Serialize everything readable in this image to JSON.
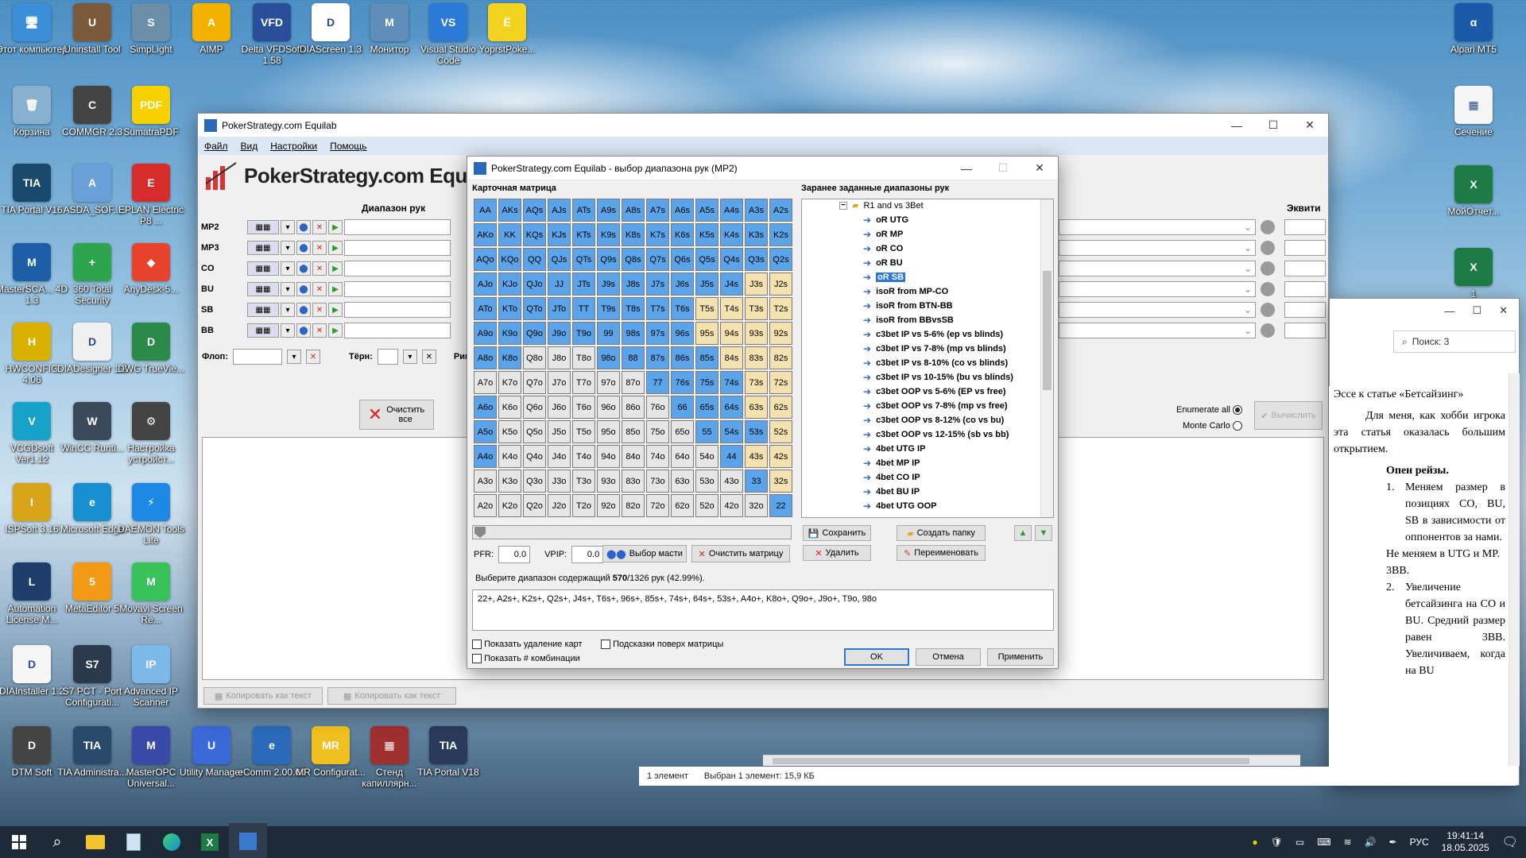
{
  "desktop_icons": [
    {
      "label": "Этот компьютер",
      "color": "#3b8fd9",
      "glyph": "🖥"
    },
    {
      "label": "Uninstall Tool",
      "color": "#7a5a3a",
      "glyph": "U"
    },
    {
      "label": "SimpLight",
      "color": "#6b8fa8",
      "glyph": "S"
    },
    {
      "label": "AIMP",
      "color": "#f2b100",
      "glyph": "A"
    },
    {
      "label": "Delta VFDSoft 1.58",
      "color": "#2a4f9a",
      "glyph": "VFD"
    },
    {
      "label": "DIAScreen 1.3",
      "color": "#ffffff",
      "glyph": "D"
    },
    {
      "label": "Монитор",
      "color": "#5f8fb8",
      "glyph": "M"
    },
    {
      "label": "Visual Studio Code",
      "color": "#2b7bd6",
      "glyph": "VS"
    },
    {
      "label": "YoprstPoke...",
      "color": "#f1d21f",
      "glyph": "Ё"
    },
    {
      "label": "Корзина",
      "color": "#8ab0cf",
      "glyph": "🗑"
    },
    {
      "label": "COMMGR 2.3",
      "color": "#444",
      "glyph": "C"
    },
    {
      "label": "SumatraPDF",
      "color": "#f7d000",
      "glyph": "PDF"
    },
    {
      "label": "TIA Portal V16",
      "color": "#1a4a6b",
      "glyph": "TIA"
    },
    {
      "label": "ASDA_SOF...",
      "color": "#6aa0d8",
      "glyph": "A"
    },
    {
      "label": "EPLAN Electric P8 ...",
      "color": "#d62c2c",
      "glyph": "E"
    },
    {
      "label": "MasterSCA... 4D 1.3",
      "color": "#1c5fa8",
      "glyph": "M"
    },
    {
      "label": "360 Total Security",
      "color": "#2ea44f",
      "glyph": "+"
    },
    {
      "label": "AnyDesk-5...",
      "color": "#e8432d",
      "glyph": "◆"
    },
    {
      "label": "HWCONFIG 4.06",
      "color": "#d9b100",
      "glyph": "H"
    },
    {
      "label": "DIADesigner 1.3",
      "color": "#f0f0f0",
      "glyph": "D"
    },
    {
      "label": "DWG TrueVie...",
      "color": "#2b8a4a",
      "glyph": "D"
    },
    {
      "label": "VCGDsoft Ver1.12",
      "color": "#17a2c9",
      "glyph": "V"
    },
    {
      "label": "WinCC Runti...",
      "color": "#3a4a5a",
      "glyph": "W"
    },
    {
      "label": "Настройка устройст...",
      "color": "#444",
      "glyph": "⚙"
    },
    {
      "label": "ISPSoft 3.16",
      "color": "#d8a51a",
      "glyph": "I"
    },
    {
      "label": "Microsoft Edge",
      "color": "#1a8fd0",
      "glyph": "e"
    },
    {
      "label": "DAEMON Tools Lite",
      "color": "#1e88e5",
      "glyph": "⚡"
    },
    {
      "label": "Automation License M...",
      "color": "#1f3d6b",
      "glyph": "L"
    },
    {
      "label": "MetaEditor 5",
      "color": "#f29a16",
      "glyph": "5"
    },
    {
      "label": "Movavi Screen Re...",
      "color": "#37c25a",
      "glyph": "M"
    },
    {
      "label": "DIAInstaller 1.2",
      "color": "#f5f5f5",
      "glyph": "D"
    },
    {
      "label": "S7 PCT - Port Configurati...",
      "color": "#2a3a4a",
      "glyph": "S7"
    },
    {
      "label": "Advanced IP Scanner",
      "color": "#7cb9e8",
      "glyph": "IP"
    },
    {
      "label": "DTM Soft",
      "color": "#444",
      "glyph": "D"
    },
    {
      "label": "TIA Administra...",
      "color": "#2a4a6b",
      "glyph": "TIA"
    },
    {
      "label": "MasterOPC Universal...",
      "color": "#3a4aa8",
      "glyph": "M"
    },
    {
      "label": "Utility Manager",
      "color": "#3a6ad8",
      "glyph": "U"
    },
    {
      "label": "eComm 2.00.00",
      "color": "#2a6ab8",
      "glyph": "e"
    },
    {
      "label": "MR Configurat...",
      "color": "#f0c020",
      "glyph": "MR"
    },
    {
      "label": "Стенд капиллярн...",
      "color": "#a03030",
      "glyph": "▦"
    },
    {
      "label": "TIA Portal V18",
      "color": "#2a3a5a",
      "glyph": "TIA"
    },
    {
      "label": "Alpari MT5",
      "color": "#1a5aa8",
      "glyph": "α"
    },
    {
      "label": "Сечение",
      "color": "#f5f5f5",
      "glyph": "▦"
    },
    {
      "label": "МойОтчет...",
      "color": "#1e7b45",
      "glyph": "X"
    },
    {
      "label": "1",
      "color": "#1e7b45",
      "glyph": "X"
    }
  ],
  "main_window": {
    "title": "PokerStrategy.com Equilab",
    "menu": [
      "Файл",
      "Вид",
      "Настройки",
      "Помощь"
    ],
    "logo_text": "PokerStrategy.com Equ",
    "range_header": "Диапазон рук",
    "equity_header": "Эквити",
    "players": [
      "MP2",
      "MP3",
      "CO",
      "BU",
      "SB",
      "BB"
    ],
    "flop_label": "Флоп:",
    "turn_label": "Тёрн:",
    "river_label": "Ривер:",
    "clear_all": "Очистить все",
    "enumerate_all": "Enumerate all",
    "monte_carlo": "Monte Carlo",
    "calculate": "Вычислить",
    "copy_text_1": "Копировать как текст",
    "copy_text_2": "Копировать как текст"
  },
  "dialog": {
    "title": "PokerStrategy.com Equilab - выбор диапазона рук (MP2)",
    "matrix_label": "Карточная матрица",
    "preset_label": "Заранее заданные диапазоны рук",
    "pfr_label": "PFR:",
    "pfr_value": "0.0",
    "vpip_label": "VPIP:",
    "vpip_value": "0.0",
    "suit_button": "Выбор масти",
    "clear_matrix": "Очистить матрицу",
    "save": "Сохранить",
    "create_folder": "Создать папку",
    "delete": "Удалить",
    "rename": "Переименовать",
    "summary_prefix": "Выберите диапазон содержащий ",
    "summary_count": "570",
    "summary_suffix": "/1326 рук (42.99%).",
    "range_text": "22+, A2s+, K2s+, Q2s+, J4s+, T6s+, 96s+, 85s+, 74s+, 64s+, 53s+, A4o+, K8o+, Q9o+, J9o+, T9o, 98o",
    "show_card_removal": "Показать удаление карт",
    "show_hints": "Подсказки поверх матрицы",
    "show_combos": "Показать # комбинации",
    "ok": "OK",
    "cancel": "Отмена",
    "apply": "Применить",
    "tree_folder": "R1 and vs 3Bet",
    "tree_items": [
      "oR UTG",
      "oR MP",
      "oR CO",
      "oR BU",
      "oR SB",
      "isoR from MP-CO",
      "isoR from BTN-BB",
      "isoR from BBvsSB",
      "c3bet IP vs 5-6% (ep vs blinds)",
      "c3bet IP vs 7-8% (mp vs blinds)",
      "c3bet IP vs 8-10% (co vs blinds)",
      "c3bet IP vs 10-15% (bu vs blinds)",
      "c3bet OOP vs 5-6% (EP vs free)",
      "c3bet OOP vs 7-8% (mp vs free)",
      "c3bet OOP vs 8-12% (co vs bu)",
      "c3bet OOP vs 12-15% (sb vs bb)",
      "4bet UTG IP",
      "4bet MP IP",
      "4bet CO IP",
      "4bet BU IP",
      "4bet UTG OOP"
    ],
    "tree_selected": "oR SB"
  },
  "chart_data": {
    "type": "table",
    "ranks": [
      "A",
      "K",
      "Q",
      "J",
      "T",
      "9",
      "8",
      "7",
      "6",
      "5",
      "4",
      "3",
      "2"
    ],
    "cells": [
      [
        "AA",
        "AKs",
        "AQs",
        "AJs",
        "ATs",
        "A9s",
        "A8s",
        "A7s",
        "A6s",
        "A5s",
        "A4s",
        "A3s",
        "A2s"
      ],
      [
        "AKo",
        "KK",
        "KQs",
        "KJs",
        "KTs",
        "K9s",
        "K8s",
        "K7s",
        "K6s",
        "K5s",
        "K4s",
        "K3s",
        "K2s"
      ],
      [
        "AQo",
        "KQo",
        "QQ",
        "QJs",
        "QTs",
        "Q9s",
        "Q8s",
        "Q7s",
        "Q6s",
        "Q5s",
        "Q4s",
        "Q3s",
        "Q2s"
      ],
      [
        "AJo",
        "KJo",
        "QJo",
        "JJ",
        "JTs",
        "J9s",
        "J8s",
        "J7s",
        "J6s",
        "J5s",
        "J4s",
        "J3s",
        "J2s"
      ],
      [
        "ATo",
        "KTo",
        "QTo",
        "JTo",
        "TT",
        "T9s",
        "T8s",
        "T7s",
        "T6s",
        "T5s",
        "T4s",
        "T3s",
        "T2s"
      ],
      [
        "A9o",
        "K9o",
        "Q9o",
        "J9o",
        "T9o",
        "99",
        "98s",
        "97s",
        "96s",
        "95s",
        "94s",
        "93s",
        "92s"
      ],
      [
        "A8o",
        "K8o",
        "Q8o",
        "J8o",
        "T8o",
        "98o",
        "88",
        "87s",
        "86s",
        "85s",
        "84s",
        "83s",
        "82s"
      ],
      [
        "A7o",
        "K7o",
        "Q7o",
        "J7o",
        "T7o",
        "97o",
        "87o",
        "77",
        "76s",
        "75s",
        "74s",
        "73s",
        "72s"
      ],
      [
        "A6o",
        "K6o",
        "Q6o",
        "J6o",
        "T6o",
        "96o",
        "86o",
        "76o",
        "66",
        "65s",
        "64s",
        "63s",
        "62s"
      ],
      [
        "A5o",
        "K5o",
        "Q5o",
        "J5o",
        "T5o",
        "95o",
        "85o",
        "75o",
        "65o",
        "55",
        "54s",
        "53s",
        "52s"
      ],
      [
        "A4o",
        "K4o",
        "Q4o",
        "J4o",
        "T4o",
        "94o",
        "84o",
        "74o",
        "64o",
        "54o",
        "44",
        "43s",
        "42s"
      ],
      [
        "A3o",
        "K3o",
        "Q3o",
        "J3o",
        "T3o",
        "93o",
        "83o",
        "73o",
        "63o",
        "53o",
        "43o",
        "33",
        "32s"
      ],
      [
        "A2o",
        "K2o",
        "Q2o",
        "J2o",
        "T2o",
        "92o",
        "82o",
        "72o",
        "62o",
        "52o",
        "42o",
        "32o",
        "22"
      ]
    ],
    "selected": [
      "AA",
      "AKs",
      "AQs",
      "AJs",
      "ATs",
      "A9s",
      "A8s",
      "A7s",
      "A6s",
      "A5s",
      "A4s",
      "A3s",
      "A2s",
      "AKo",
      "KK",
      "KQs",
      "KJs",
      "KTs",
      "K9s",
      "K8s",
      "K7s",
      "K6s",
      "K5s",
      "K4s",
      "K3s",
      "K2s",
      "AQo",
      "KQo",
      "QQ",
      "QJs",
      "QTs",
      "Q9s",
      "Q8s",
      "Q7s",
      "Q6s",
      "Q5s",
      "Q4s",
      "Q3s",
      "Q2s",
      "AJo",
      "KJo",
      "QJo",
      "JJ",
      "JTs",
      "J9s",
      "J8s",
      "J7s",
      "J6s",
      "J5s",
      "J4s",
      "ATo",
      "KTo",
      "QTo",
      "JTo",
      "TT",
      "T9s",
      "T8s",
      "T7s",
      "T6s",
      "A9o",
      "K9o",
      "Q9o",
      "J9o",
      "T9o",
      "99",
      "98s",
      "97s",
      "96s",
      "A8o",
      "K8o",
      "98o",
      "88",
      "87s",
      "86s",
      "85s",
      "77",
      "76s",
      "75s",
      "74s",
      "66",
      "65s",
      "64s",
      "A6o",
      "A5o",
      "55",
      "54s",
      "53s",
      "A4o",
      "44",
      "33",
      "22"
    ],
    "colors": {
      "selected": "#5ba4ea",
      "pair": "#c8c8c8",
      "suited": "#f4e1b0",
      "offsuit": "#e6e6e6"
    }
  },
  "explorer": {
    "search_placeholder": "Поиск: 3",
    "status_items": "1 элемент",
    "status_selected": "Выбран 1 элемент: 15,9 КБ"
  },
  "word_doc": {
    "heading": "Эссе к статье «Бетсайзинг»",
    "p1": "Для меня, как хобби игрока эта статья оказалась большим открытием.",
    "open_raises": "Опен рейзы.",
    "li1": "Меняем размер в позициях CO, BU, SB в зависимости от оппонентов за нами.",
    "line2": "Не меняем в UTG и MP. 3BB.",
    "li2": "Увеличение бетсайзинга на CO и BU. Средний размер равен 3BB. Увеличиваем, когда на BU"
  },
  "taskbar": {
    "lang": "РУС",
    "time": "19:41:14",
    "date": "18.05.2025"
  }
}
